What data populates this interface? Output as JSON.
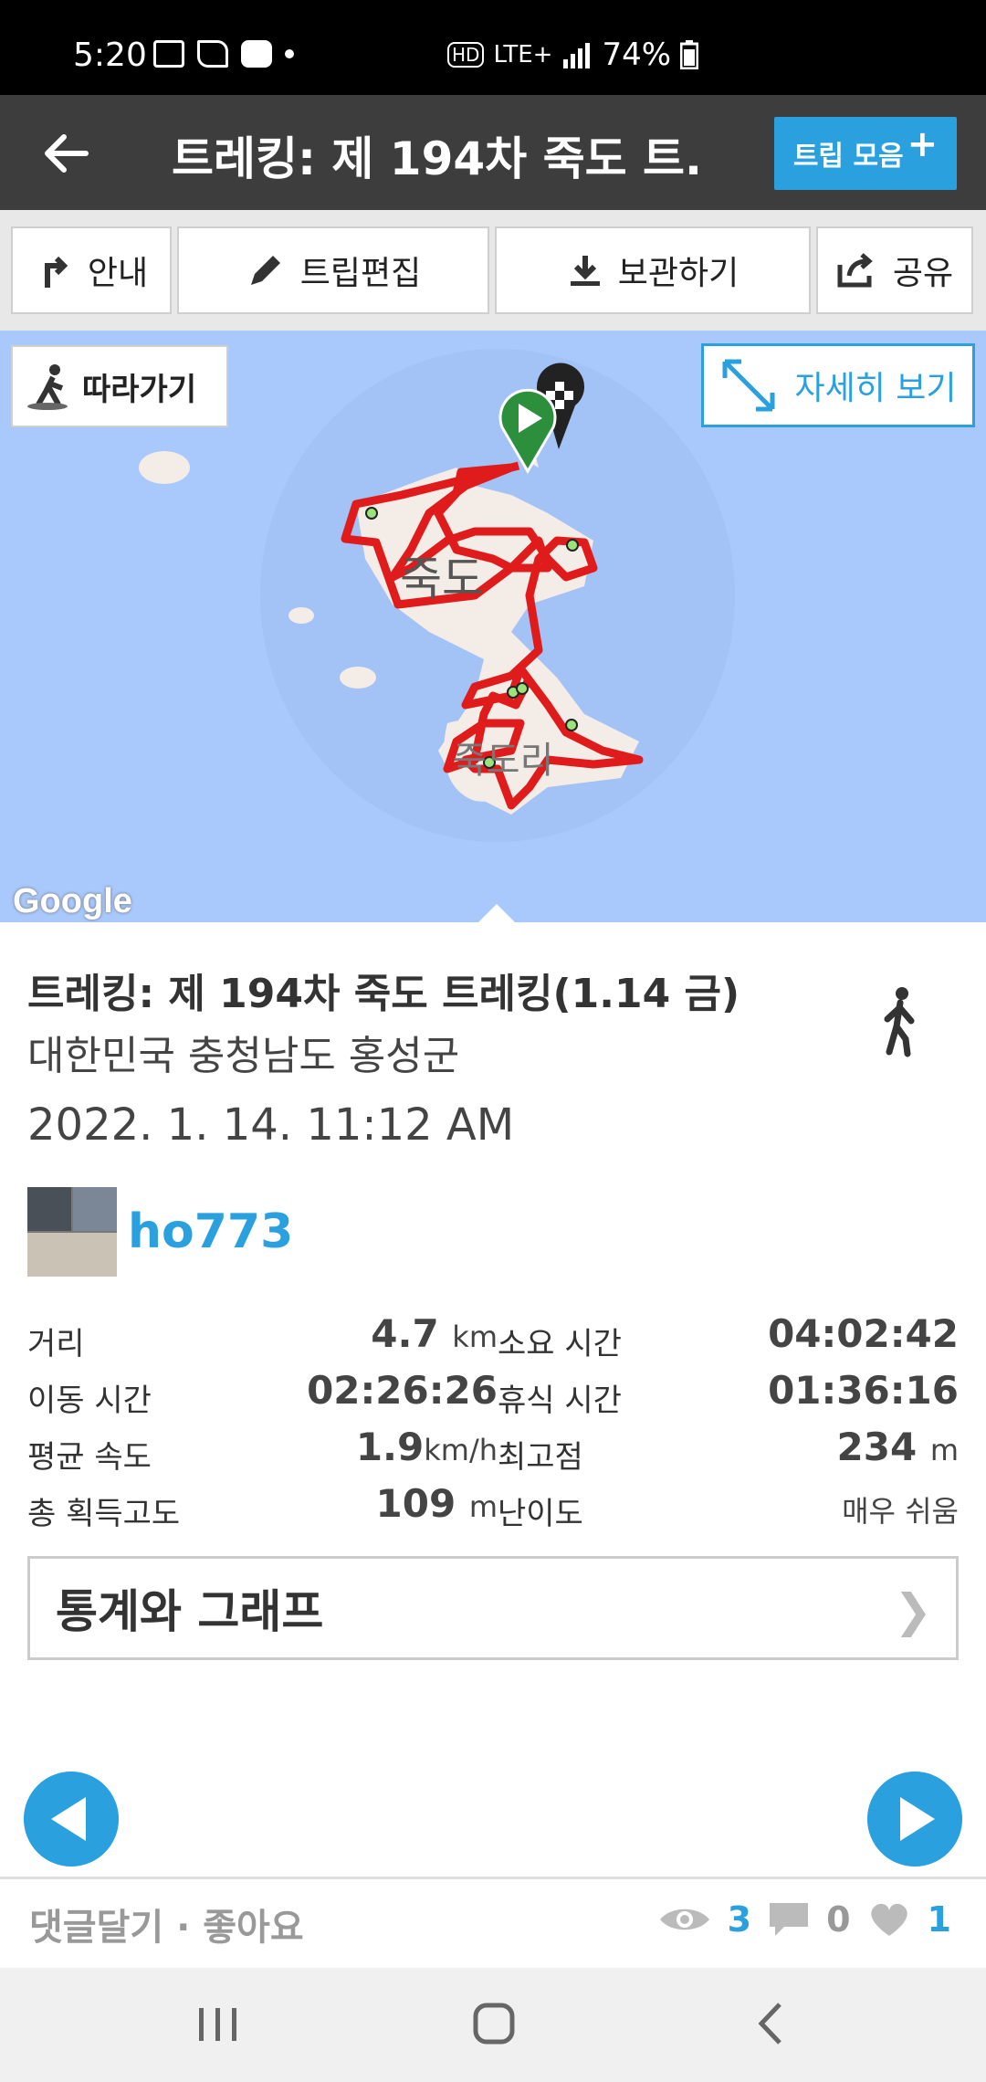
{
  "status": {
    "time": "5:20",
    "network": "LTE+",
    "battery": "74%"
  },
  "appbar": {
    "title": "트레킹: 제 194차 죽도 트...",
    "collect_label": "트립 모음"
  },
  "toolbar": {
    "guide": "안내",
    "edit": "트립편집",
    "save": "보관하기",
    "share": "공유"
  },
  "map": {
    "follow_label": "따라가기",
    "detail_label": "자세히 보기",
    "island_label": "죽도",
    "village_label": "죽도리",
    "attribution": "Google"
  },
  "trip": {
    "title": "트레킹: 제 194차 죽도 트레킹(1.14 금)",
    "location": "대한민국 충청남도 홍성군",
    "date": "2022. 1. 14. 11:12 AM",
    "user": "ho773"
  },
  "stats": {
    "distance_label": "거리",
    "distance_value": "4.7",
    "distance_unit": "km",
    "duration_label": "소요 시간",
    "duration_value": "04:02:42",
    "moving_label": "이동 시간",
    "moving_value": "02:26:26",
    "rest_label": "휴식 시간",
    "rest_value": "01:36:16",
    "speed_label": "평균 속도",
    "speed_value": "1.9",
    "speed_unit": "km/h",
    "highest_label": "최고점",
    "highest_value": "234",
    "highest_unit": "m",
    "gain_label": "총 획득고도",
    "gain_value": "109",
    "gain_unit": "m",
    "difficulty_label": "난이도",
    "difficulty_value": "매우 쉬움"
  },
  "graph_label": "통계와 그래프",
  "footer": {
    "actions": "댓글달기 · 좋아요",
    "views": "3",
    "comments": "0",
    "likes": "1"
  },
  "colors": {
    "accent": "#2aa0df",
    "track": "#e01b1b",
    "map_water": "#a9c8fb",
    "appbar": "#3d3d3d"
  }
}
